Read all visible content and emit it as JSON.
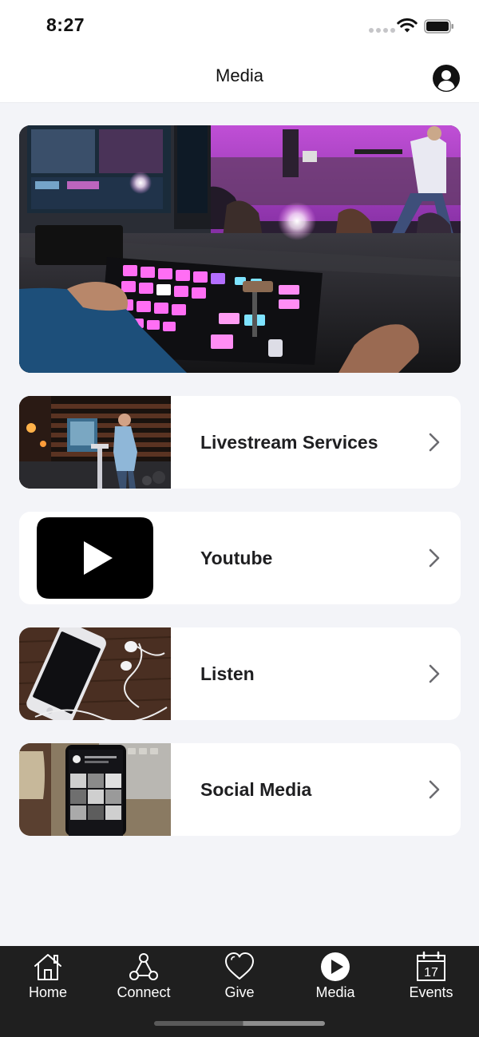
{
  "status_bar": {
    "time": "8:27"
  },
  "header": {
    "title": "Media",
    "profile_icon": "person-circle-icon"
  },
  "hero": {
    "image": "production-control-room-photo"
  },
  "media_items": [
    {
      "label": "Livestream Services",
      "thumbnail": "pastor-preaching-photo",
      "icon": "chevron-right-icon"
    },
    {
      "label": "Youtube",
      "thumbnail": "youtube-logo-icon",
      "icon": "chevron-right-icon"
    },
    {
      "label": "Listen",
      "thumbnail": "phone-earbuds-photo",
      "icon": "chevron-right-icon"
    },
    {
      "label": "Social Media",
      "thumbnail": "instagram-phone-photo",
      "icon": "chevron-right-icon"
    }
  ],
  "tab_bar": {
    "tabs": [
      {
        "label": "Home",
        "icon": "house-icon"
      },
      {
        "label": "Connect",
        "icon": "network-icon"
      },
      {
        "label": "Give",
        "icon": "heart-icon"
      },
      {
        "label": "Media",
        "icon": "play-circle-icon",
        "active": true
      },
      {
        "label": "Events",
        "icon": "calendar-icon",
        "day": "17"
      }
    ]
  },
  "colors": {
    "background": "#f3f4f8",
    "card": "#ffffff",
    "tab_bar": "#1f1f1f",
    "text": "#1f1f21"
  }
}
